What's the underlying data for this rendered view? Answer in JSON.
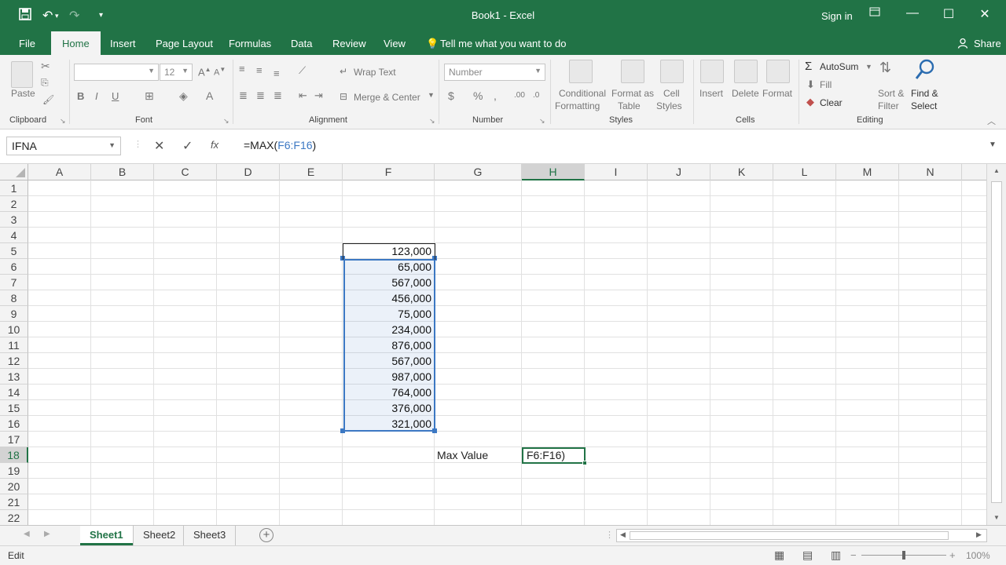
{
  "window": {
    "title": "Book1 - Excel",
    "sign_in": "Sign in",
    "share": "Share"
  },
  "ribbon_tabs": [
    "File",
    "Home",
    "Insert",
    "Page Layout",
    "Formulas",
    "Data",
    "Review",
    "View"
  ],
  "active_tab": "Home",
  "tell_me": "Tell me what you want to do",
  "ribbon": {
    "clipboard": {
      "label": "Clipboard",
      "paste": "Paste"
    },
    "font": {
      "label": "Font",
      "font_name": "",
      "font_size": "12"
    },
    "alignment": {
      "label": "Alignment",
      "wrap_text": "Wrap Text",
      "merge_center": "Merge & Center"
    },
    "number": {
      "label": "Number",
      "format": "Number"
    },
    "styles": {
      "label": "Styles",
      "conditional_1": "Conditional",
      "conditional_2": "Formatting",
      "format_as_1": "Format as",
      "format_as_2": "Table",
      "cell_styles_1": "Cell",
      "cell_styles_2": "Styles"
    },
    "cells": {
      "label": "Cells",
      "insert": "Insert",
      "delete": "Delete",
      "format": "Format"
    },
    "editing": {
      "label": "Editing",
      "autosum": "AutoSum",
      "fill": "Fill",
      "clear": "Clear",
      "sort_1": "Sort &",
      "sort_2": "Filter",
      "find_1": "Find &",
      "find_2": "Select"
    }
  },
  "formula_bar": {
    "name_box": "IFNA",
    "formula_prefix": "=MAX(",
    "formula_ref": "F6:F16",
    "formula_suffix": ")"
  },
  "columns": [
    "A",
    "B",
    "C",
    "D",
    "E",
    "F",
    "G",
    "H",
    "I",
    "J",
    "K",
    "L",
    "M",
    "N"
  ],
  "rows": [
    "1",
    "2",
    "3",
    "4",
    "5",
    "6",
    "7",
    "8",
    "9",
    "10",
    "11",
    "12",
    "13",
    "14",
    "15",
    "16",
    "17",
    "18",
    "19",
    "20",
    "21",
    "22"
  ],
  "cells": {
    "F5": "123,000",
    "F6": "65,000",
    "F7": "567,000",
    "F8": "456,000",
    "F9": "75,000",
    "F10": "234,000",
    "F11": "876,000",
    "F12": "567,000",
    "F13": "987,000",
    "F14": "764,000",
    "F15": "376,000",
    "F16": "321,000",
    "G18": "Max Value",
    "H18": "F6:F16)"
  },
  "sheets": [
    "Sheet1",
    "Sheet2",
    "Sheet3"
  ],
  "active_sheet": "Sheet1",
  "status": {
    "mode": "Edit",
    "zoom": "100%"
  },
  "colors": {
    "excel_green": "#217346",
    "range_blue": "#3c78c3"
  }
}
